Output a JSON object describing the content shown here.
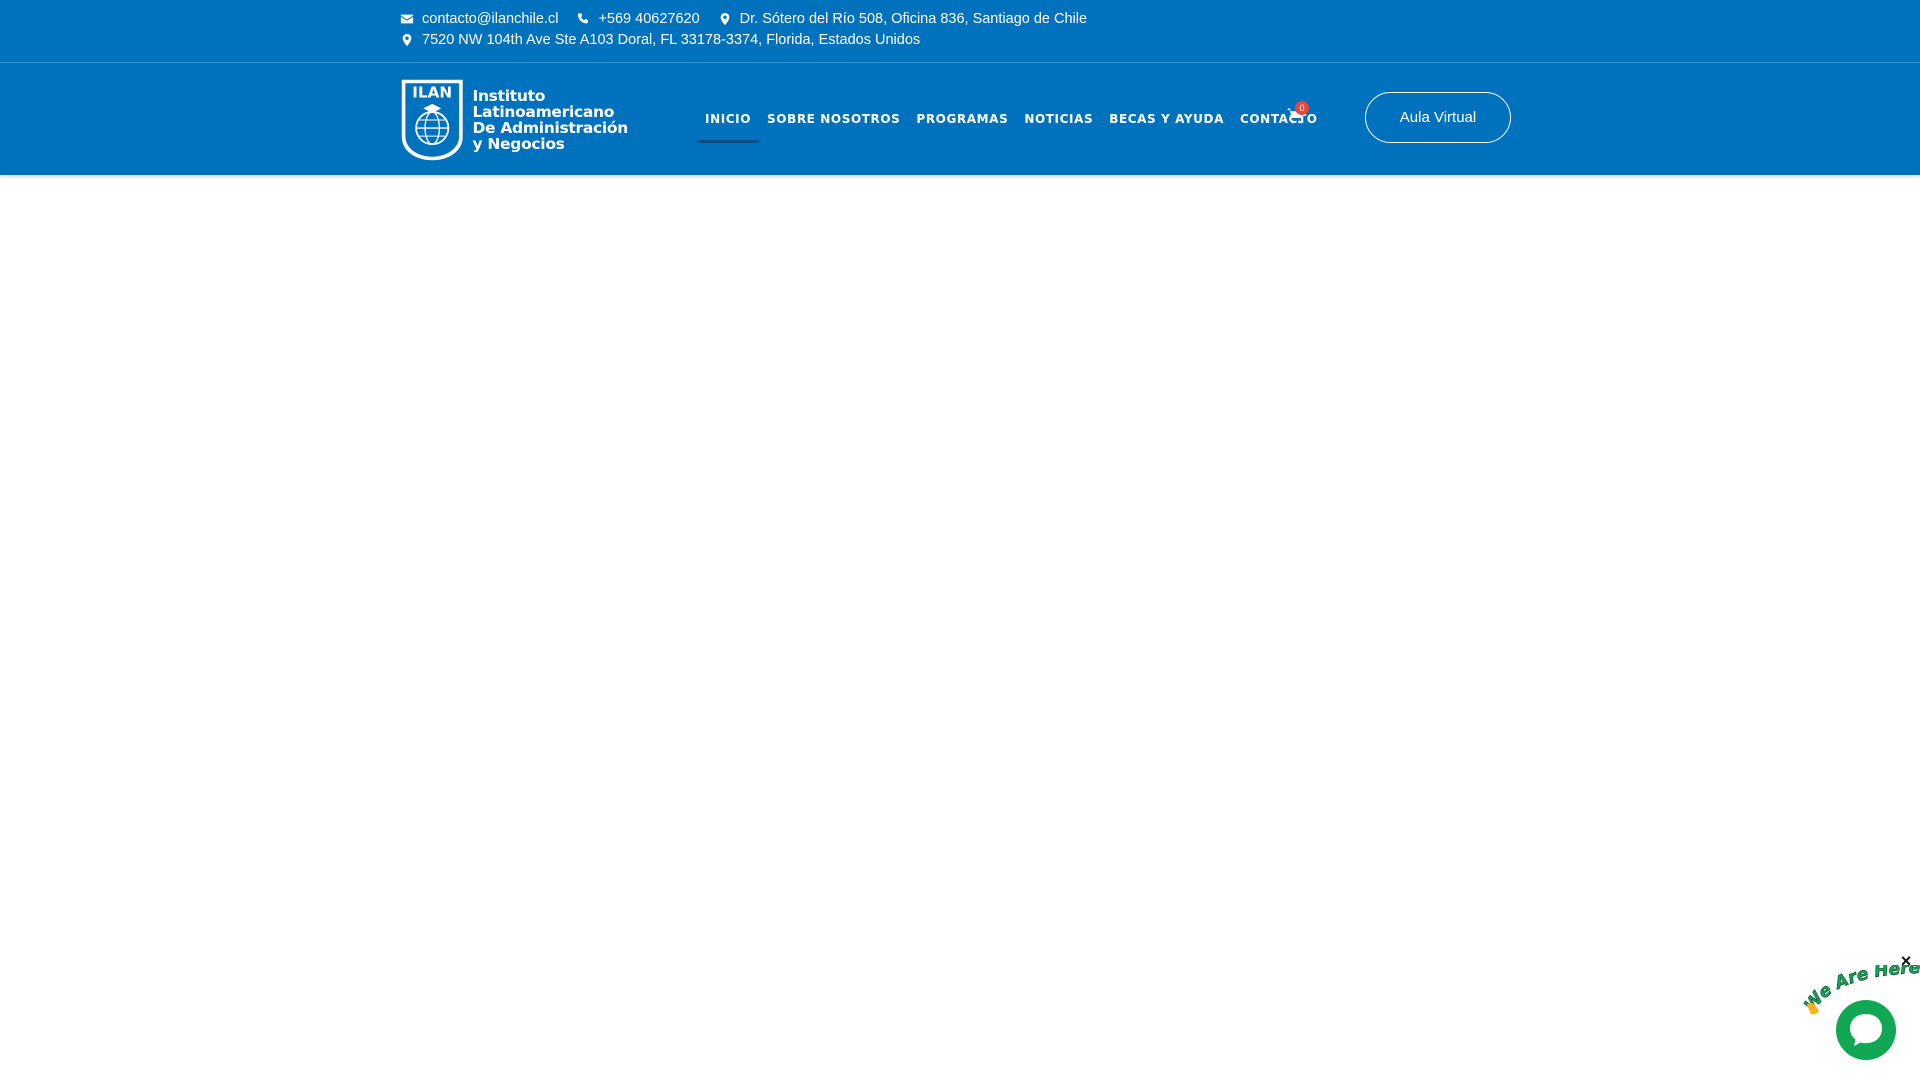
{
  "topbar": {
    "email": "contacto@ilanchile.cl",
    "phone": "+569 40627620",
    "address_chile": "Dr. Sótero del Río 508, Oficina 836, Santiago de Chile",
    "address_usa": "7520 NW 104th Ave Ste A103 Doral, FL 33178-3374, Florida, Estados Unidos"
  },
  "logo": {
    "badge": "ILAN",
    "line1": "Instituto",
    "line2": "Latinoamericano",
    "line3": "De Administración",
    "line4": "y Negocios"
  },
  "nav": {
    "items": [
      {
        "label": "INICIO",
        "active": true
      },
      {
        "label": "SOBRE NOSOTROS"
      },
      {
        "label": "PROGRAMAS"
      },
      {
        "label": "NOTICIAS"
      },
      {
        "label": "BECAS Y AYUDA"
      },
      {
        "label": "CONTACTO"
      }
    ]
  },
  "cart": {
    "count": "0"
  },
  "cta": {
    "label": "Aula Virtual"
  },
  "chat": {
    "label": "We Are Here!",
    "close": "×"
  },
  "colors": {
    "brand": "#0071bc",
    "badge": "#e8453c",
    "chat": "#12a755"
  }
}
